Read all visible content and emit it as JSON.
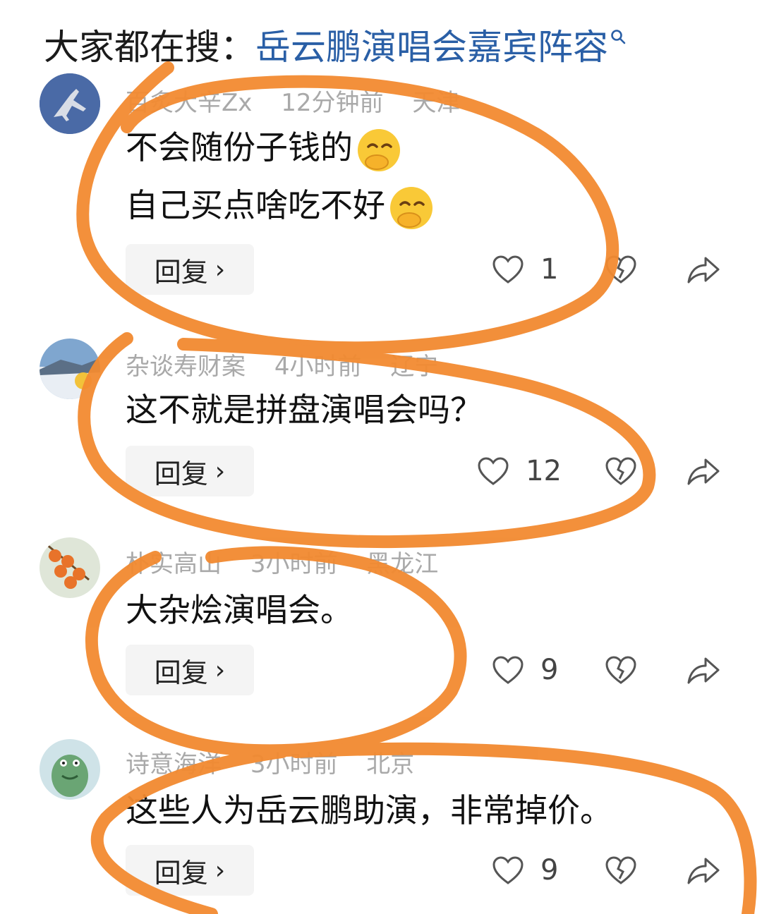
{
  "search": {
    "label": "大家都在搜：",
    "query": "岳云鹏演唱会嘉宾阵容"
  },
  "comments": [
    {
      "author": "百炙大辛Zx",
      "time": "12分钟前",
      "location": "天津",
      "lines": [
        "不会随份子钱的",
        "自己买点啥吃不好"
      ],
      "reply_label": "回复",
      "likes": "1"
    },
    {
      "author": "杂谈寿财案",
      "time": "4小时前",
      "location": "辽宁",
      "lines": [
        "这不就是拼盘演唱会吗？"
      ],
      "reply_label": "回复",
      "likes": "12"
    },
    {
      "author": "朴实高山",
      "time": "3小时前",
      "location": "黑龙江",
      "lines": [
        "大杂烩演唱会。"
      ],
      "reply_label": "回复",
      "likes": "9"
    },
    {
      "author": "诗意海洋",
      "time": "3小时前",
      "location": "北京",
      "lines": [
        "这些人为岳云鹏助演，非常掉价。"
      ],
      "reply_label": "回复",
      "likes": "9"
    }
  ],
  "colors": {
    "link": "#2a5fa6",
    "annotation": "#f28a30",
    "reply_bg": "#f4f4f4"
  },
  "icons": [
    "search-icon",
    "heart-icon",
    "broken-heart-icon",
    "share-icon",
    "chevron-right-icon",
    "face-hand-over-mouth-emoji"
  ]
}
